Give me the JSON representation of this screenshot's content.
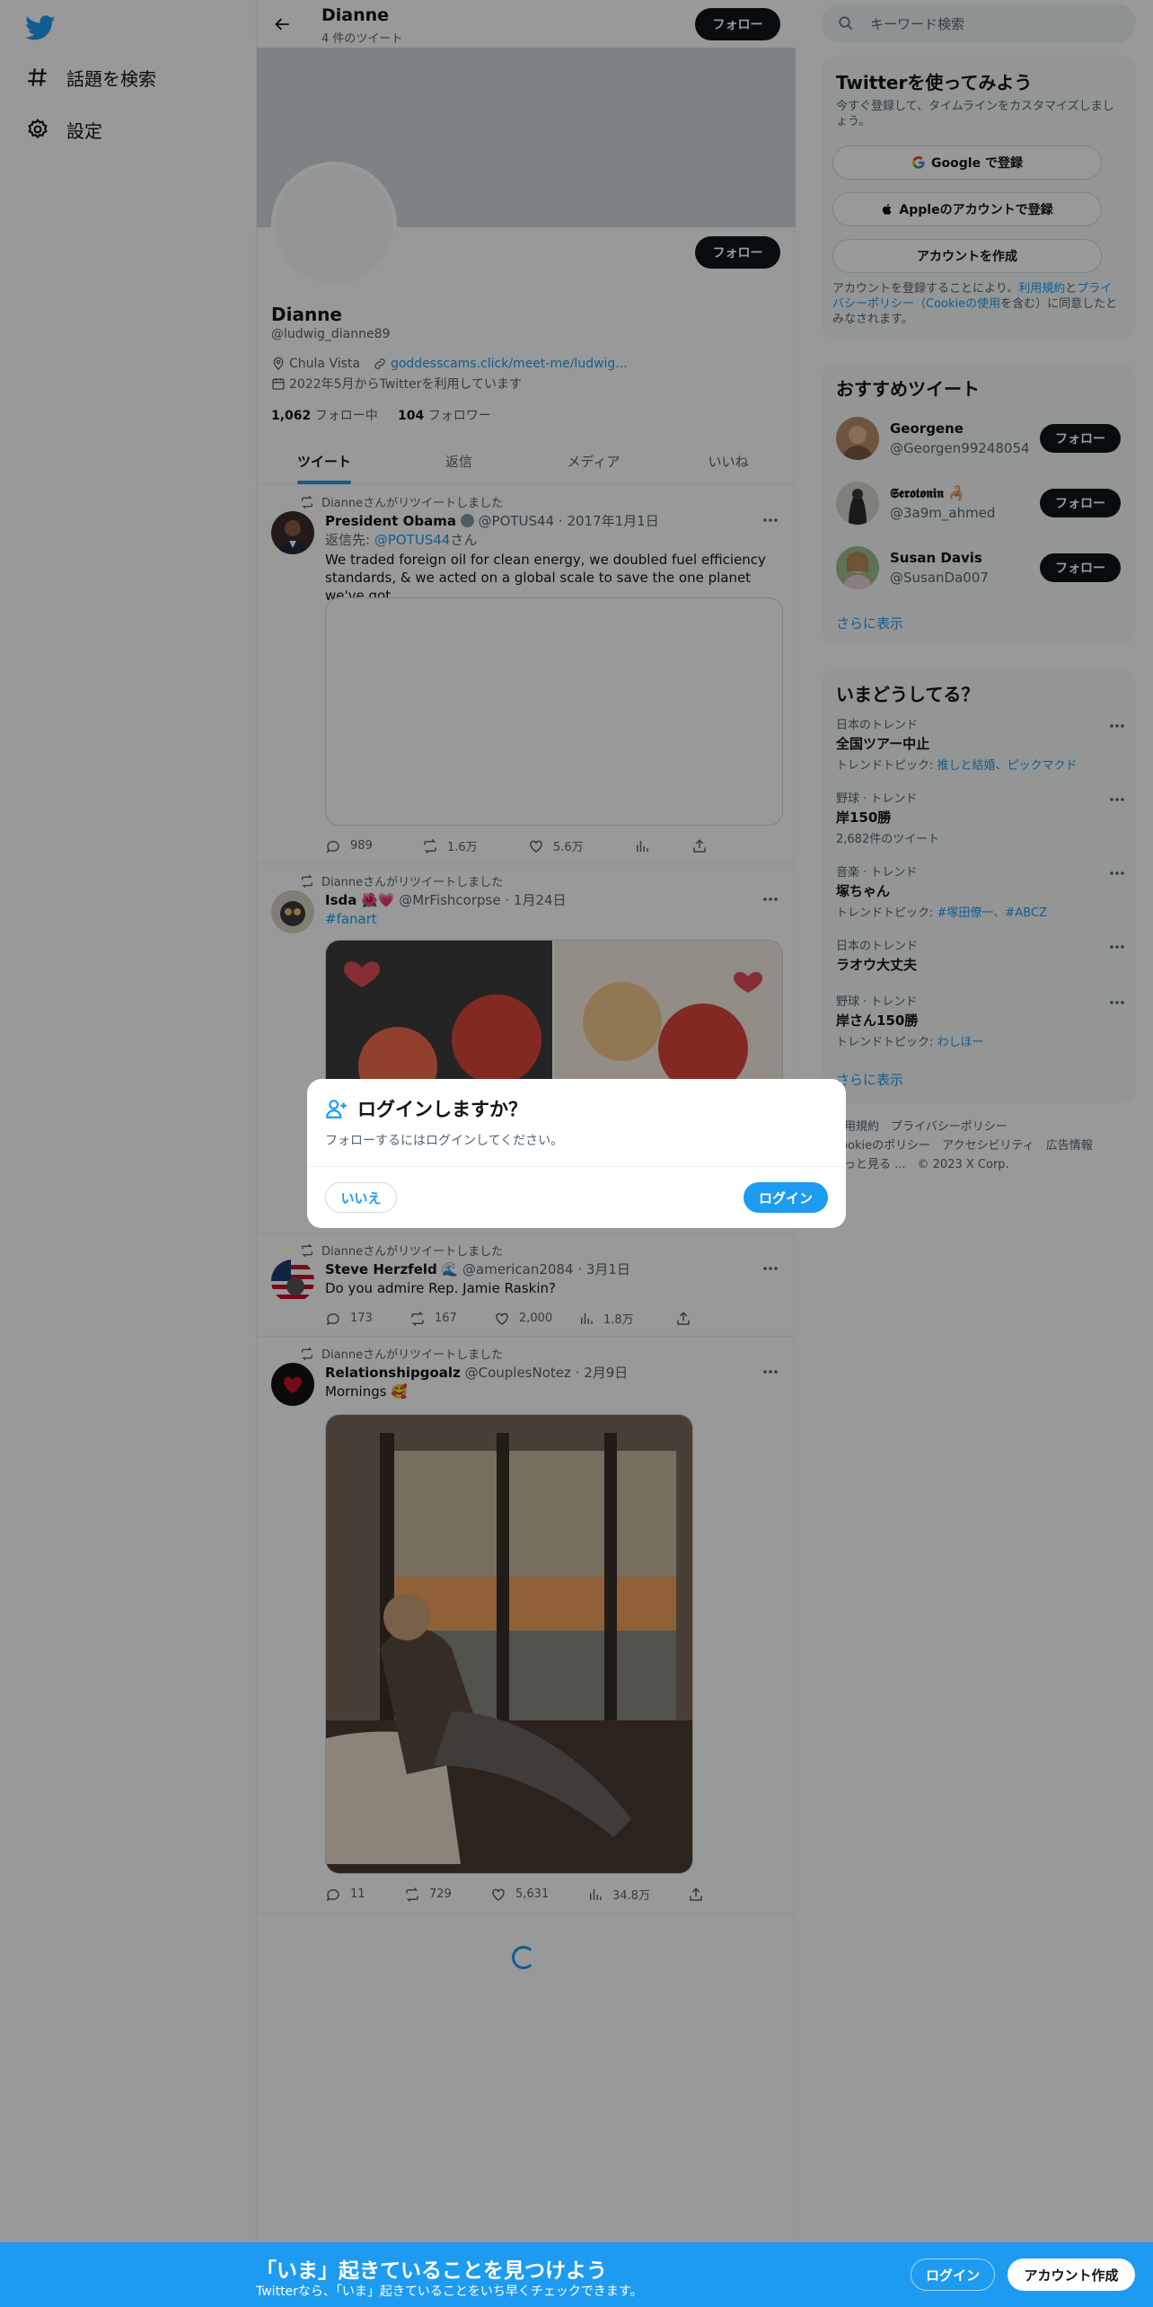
{
  "nav": {
    "explore_label": "話題を検索",
    "settings_label": "設定"
  },
  "topbar": {
    "name": "Dianne",
    "tweet_count": "4 件のツイート",
    "follow_label": "フォロー"
  },
  "profile": {
    "follow_label": "フォロー",
    "name": "Dianne",
    "handle": "@ludwig_dianne89",
    "location": "Chula Vista",
    "website": "goddesscams.click/meet-me/ludwig...",
    "joined": "2022年5月からTwitterを利用しています",
    "following_count": "1,062",
    "following_label": "フォロー中",
    "followers_count": "104",
    "followers_label": "フォロワー"
  },
  "tabs": [
    {
      "label": "ツイート"
    },
    {
      "label": "返信"
    },
    {
      "label": "メディア"
    },
    {
      "label": "いいね"
    }
  ],
  "tweets": [
    {
      "retweet_note": "Dianneさんがリツイートしました",
      "name": "President Obama",
      "handle": "@POTUS44",
      "date": "2017年1月1日",
      "reply_prefix": "返信先: ",
      "reply_handle": "@POTUS44",
      "reply_suffix": "さん",
      "text": "We traded foreign oil for clean energy, we doubled fuel efficiency standards, & we acted on a global scale to save the one planet we've got.",
      "replies": "989",
      "retweets": "1.6万",
      "likes": "5.6万"
    },
    {
      "retweet_note": "Dianneさんがリツイートしました",
      "name": "Isda",
      "name_emoji": "🌺💗",
      "handle": "@MrFishcorpse",
      "date": "1月24日",
      "hashtag": "#fanart"
    },
    {
      "retweet_note": "Dianneさんがリツイートしました",
      "name": "Steve Herzfeld",
      "name_emoji": "🌊",
      "handle": "@american2084",
      "date": "3月1日",
      "text": "Do you admire Rep. Jamie Raskin?",
      "replies": "173",
      "retweets": "167",
      "likes": "2,000",
      "views": "1.8万"
    },
    {
      "retweet_note": "Dianneさんがリツイートしました",
      "name": "Relationshipgoalz",
      "handle": "@CouplesNotez",
      "date": "2月9日",
      "text": "Mornings 🥰",
      "replies": "11",
      "retweets": "729",
      "likes": "5,631",
      "views": "34.8万"
    }
  ],
  "search": {
    "placeholder": "キーワード検索"
  },
  "signup": {
    "title": "Twitterを使ってみよう",
    "subtitle": "今すぐ登録して、タイムラインをカスタマイズしましょう。",
    "google_label": "Google で登録",
    "apple_label": "Appleのアカウントで登録",
    "create_label": "アカウントを作成",
    "terms_prefix": "アカウントを登録することにより、",
    "terms_link": "利用規約",
    "terms_and": "と",
    "privacy_link": "プライバシーポリシー",
    "cookie_link": "（Cookieの使用",
    "terms_suffix": "を含む）に同意したとみなされます。"
  },
  "recommended": {
    "title": "おすすめツイート",
    "users": [
      {
        "name": "Georgene",
        "handle": "@Georgen99248054",
        "button": "フォロー"
      },
      {
        "name": "𝕾𝖊𝖗𝖔𝖙𝖔𝖓𝖎𝖓 🦂",
        "handle": "@3a9m_ahmed",
        "button": "フォロー"
      },
      {
        "name": "Susan Davis",
        "handle": "@SusanDa007",
        "button": "フォロー"
      }
    ],
    "more": "さらに表示"
  },
  "trends": {
    "title": "いまどうしてる？",
    "items": [
      {
        "context": "日本のトレンド",
        "name": "全国ツアー中止",
        "sub_prefix": "トレンドトピック: ",
        "sub_link": "推しと結婚、ピックマクド"
      },
      {
        "context": "野球 · トレンド",
        "name": "岸150勝",
        "sub_prefix": "2,682件のツイート",
        "sub_link": ""
      },
      {
        "context": "音楽 · トレンド",
        "name": "塚ちゃん",
        "sub_prefix": "トレンドトピック: ",
        "sub_link": "#塚田僚一、#ABCZ"
      },
      {
        "context": "日本のトレンド",
        "name": "ラオウ大丈夫",
        "sub_prefix": "",
        "sub_link": ""
      },
      {
        "context": "野球 · トレンド",
        "name": "岸さん150勝",
        "sub_prefix": "トレンドトピック: ",
        "sub_link": "わしほー"
      }
    ],
    "more": "さらに表示"
  },
  "footer": {
    "line1": "利用規約　プライバシーポリシー",
    "line2": "Cookieのポリシー　アクセシビリティ　広告情報",
    "line3": "もっと見る ...　© 2023 X Corp."
  },
  "modal": {
    "title": "ログインしますか？",
    "text": "フォローするにはログインしてください。",
    "no_label": "いいえ",
    "yes_label": "ログイン"
  },
  "bottombar": {
    "title": "「いま」起きていることを見つけよう",
    "subtitle": "Twitterなら、「いま」起きていることをいち早くチェックできます。",
    "login_label": "ログイン",
    "signup_label": "アカウント作成"
  },
  "colors": {
    "accent": "#1d9bf0",
    "text": "#0f1419",
    "muted": "#536471",
    "overlay": "rgba(0,0,0,0.4)"
  }
}
